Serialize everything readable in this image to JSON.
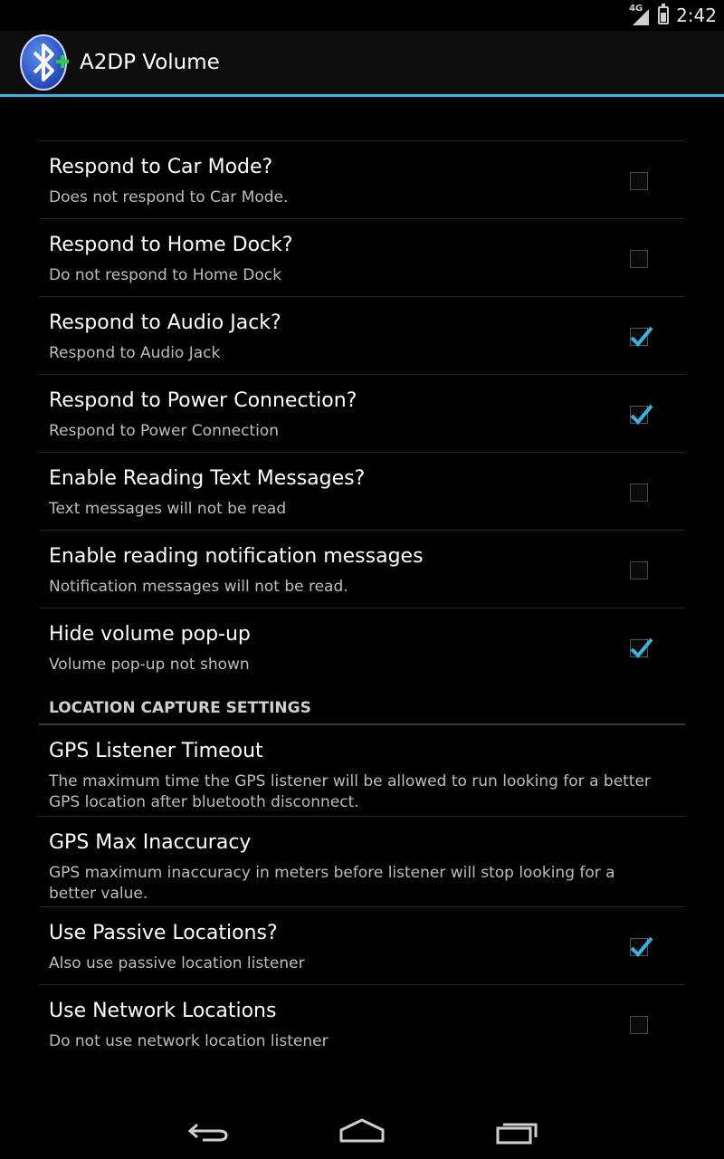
{
  "status_bar": {
    "network": "4G",
    "time": "2:42"
  },
  "action_bar": {
    "title": "A2DP Volume",
    "icon": "bluetooth-app-icon"
  },
  "preferences": [
    {
      "title": "Respond to Car Mode?",
      "summary": "Does not respond to Car Mode.",
      "checked": false
    },
    {
      "title": "Respond to Home Dock?",
      "summary": "Do not respond to Home Dock",
      "checked": false
    },
    {
      "title": "Respond to Audio Jack?",
      "summary": "Respond to Audio Jack",
      "checked": true
    },
    {
      "title": "Respond to Power Connection?",
      "summary": "Respond to Power Connection",
      "checked": true
    },
    {
      "title": "Enable Reading Text Messages?",
      "summary": "Text messages will not be read",
      "checked": false
    },
    {
      "title": "Enable reading notification messages",
      "summary": "Notification messages will not be read.",
      "checked": false
    },
    {
      "title": "Hide volume pop-up",
      "summary": "Volume pop-up not shown",
      "checked": true
    }
  ],
  "location_category": {
    "label": "LOCATION CAPTURE SETTINGS",
    "items": [
      {
        "title": "GPS Listener Timeout",
        "summary": "The maximum time the GPS listener will be allowed to run looking for a better GPS location after bluetooth disconnect."
      },
      {
        "title": "GPS Max Inaccuracy",
        "summary": "GPS maximum inaccuracy in meters before listener will stop looking for a better value."
      },
      {
        "title": "Use Passive Locations?",
        "summary": "Also use passive location listener",
        "checked": true
      },
      {
        "title": "Use Network Locations",
        "summary": "Do not use network location listener",
        "checked": false
      }
    ]
  },
  "nav_bar": {
    "back": "back-icon",
    "home": "home-icon",
    "recents": "recents-icon"
  },
  "colors": {
    "accent": "#33b5e5",
    "background": "#000000",
    "summary_text": "#bdbdbd"
  }
}
